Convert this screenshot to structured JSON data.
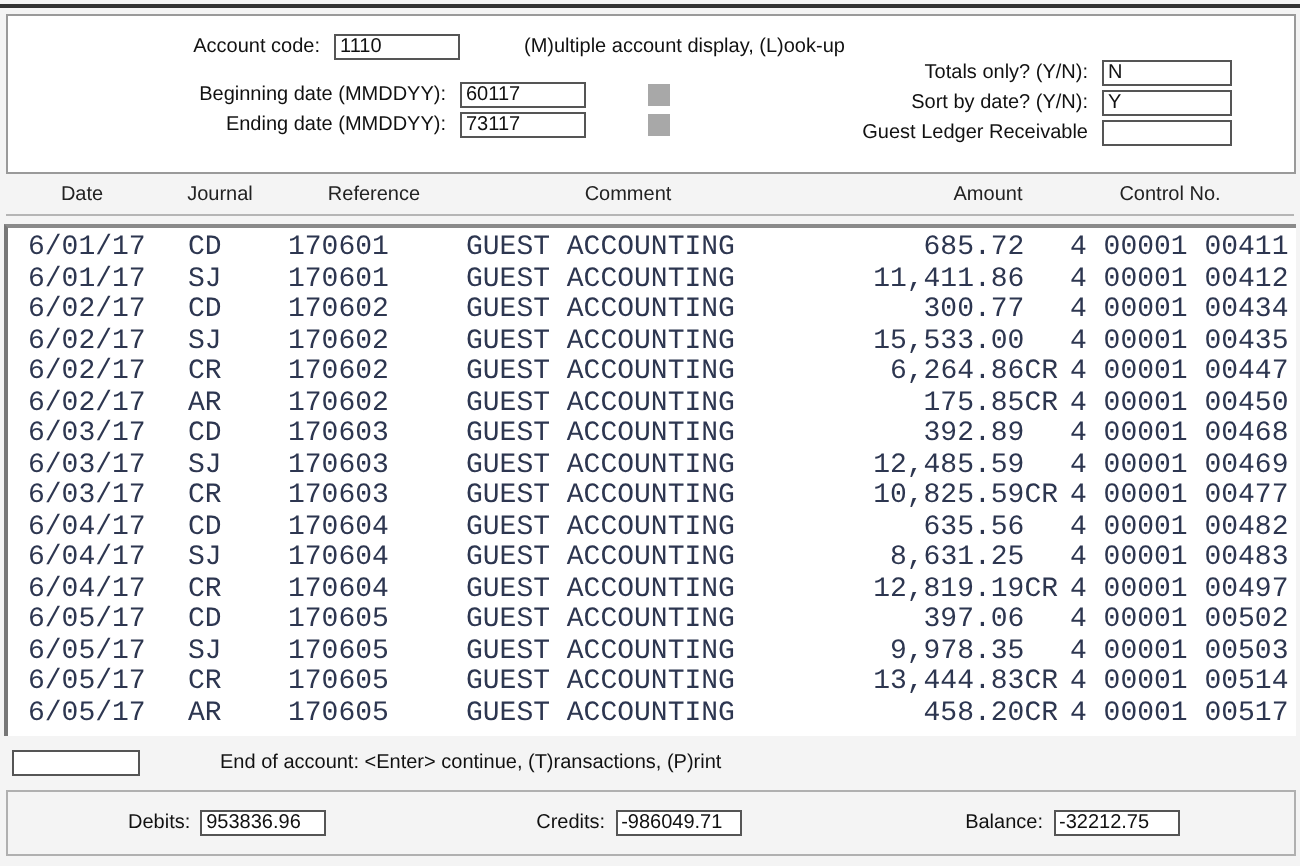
{
  "query": {
    "account_code_label": "Account code:",
    "account_code": "1110",
    "lookup_hint": "(M)ultiple account display, (L)ook-up",
    "beginning_label": "Beginning date (MMDDYY):",
    "beginning_date": "60117",
    "ending_label": "Ending date (MMDDYY):",
    "ending_date": "73117",
    "totals_only_label": "Totals only? (Y/N):",
    "totals_only": "N",
    "sort_label": "Sort by date? (Y/N):",
    "sort_by_date": "Y",
    "guest_ledger_label": "Guest Ledger Receivable"
  },
  "table": {
    "columns": [
      "Date",
      "Journal",
      "Reference",
      "Comment",
      "Amount",
      "Control No."
    ],
    "rows": [
      {
        "date": "6/01/17",
        "journal": "CD",
        "reference": "170601",
        "comment": "GUEST ACCOUNTING",
        "amount": "685.72",
        "credit": false,
        "control": "4 00001 00411"
      },
      {
        "date": "6/01/17",
        "journal": "SJ",
        "reference": "170601",
        "comment": "GUEST ACCOUNTING",
        "amount": "11,411.86",
        "credit": false,
        "control": "4 00001 00412"
      },
      {
        "date": "6/02/17",
        "journal": "CD",
        "reference": "170602",
        "comment": "GUEST ACCOUNTING",
        "amount": "300.77",
        "credit": false,
        "control": "4 00001 00434"
      },
      {
        "date": "6/02/17",
        "journal": "SJ",
        "reference": "170602",
        "comment": "GUEST ACCOUNTING",
        "amount": "15,533.00",
        "credit": false,
        "control": "4 00001 00435"
      },
      {
        "date": "6/02/17",
        "journal": "CR",
        "reference": "170602",
        "comment": "GUEST ACCOUNTING",
        "amount": "6,264.86CR",
        "credit": true,
        "control": "4 00001 00447"
      },
      {
        "date": "6/02/17",
        "journal": "AR",
        "reference": "170602",
        "comment": "GUEST ACCOUNTING",
        "amount": "175.85CR",
        "credit": true,
        "control": "4 00001 00450"
      },
      {
        "date": "6/03/17",
        "journal": "CD",
        "reference": "170603",
        "comment": "GUEST ACCOUNTING",
        "amount": "392.89",
        "credit": false,
        "control": "4 00001 00468"
      },
      {
        "date": "6/03/17",
        "journal": "SJ",
        "reference": "170603",
        "comment": "GUEST ACCOUNTING",
        "amount": "12,485.59",
        "credit": false,
        "control": "4 00001 00469"
      },
      {
        "date": "6/03/17",
        "journal": "CR",
        "reference": "170603",
        "comment": "GUEST ACCOUNTING",
        "amount": "10,825.59CR",
        "credit": true,
        "control": "4 00001 00477"
      },
      {
        "date": "6/04/17",
        "journal": "CD",
        "reference": "170604",
        "comment": "GUEST ACCOUNTING",
        "amount": "635.56",
        "credit": false,
        "control": "4 00001 00482"
      },
      {
        "date": "6/04/17",
        "journal": "SJ",
        "reference": "170604",
        "comment": "GUEST ACCOUNTING",
        "amount": "8,631.25",
        "credit": false,
        "control": "4 00001 00483"
      },
      {
        "date": "6/04/17",
        "journal": "CR",
        "reference": "170604",
        "comment": "GUEST ACCOUNTING",
        "amount": "12,819.19CR",
        "credit": true,
        "control": "4 00001 00497"
      },
      {
        "date": "6/05/17",
        "journal": "CD",
        "reference": "170605",
        "comment": "GUEST ACCOUNTING",
        "amount": "397.06",
        "credit": false,
        "control": "4 00001 00502"
      },
      {
        "date": "6/05/17",
        "journal": "SJ",
        "reference": "170605",
        "comment": "GUEST ACCOUNTING",
        "amount": "9,978.35",
        "credit": false,
        "control": "4 00001 00503"
      },
      {
        "date": "6/05/17",
        "journal": "CR",
        "reference": "170605",
        "comment": "GUEST ACCOUNTING",
        "amount": "13,444.83CR",
        "credit": true,
        "control": "4 00001 00514"
      },
      {
        "date": "6/05/17",
        "journal": "AR",
        "reference": "170605",
        "comment": "GUEST ACCOUNTING",
        "amount": "458.20CR",
        "credit": true,
        "control": "4 00001 00517"
      }
    ]
  },
  "command": {
    "prompt": "End of account: <Enter> continue, (T)ransactions, (P)rint"
  },
  "totals": [
    {
      "label": "Debits:",
      "value": "953836.96"
    },
    {
      "label": "Credits:",
      "value": "-986049.71"
    },
    {
      "label": "Balance:",
      "value": "-32212.75"
    }
  ]
}
